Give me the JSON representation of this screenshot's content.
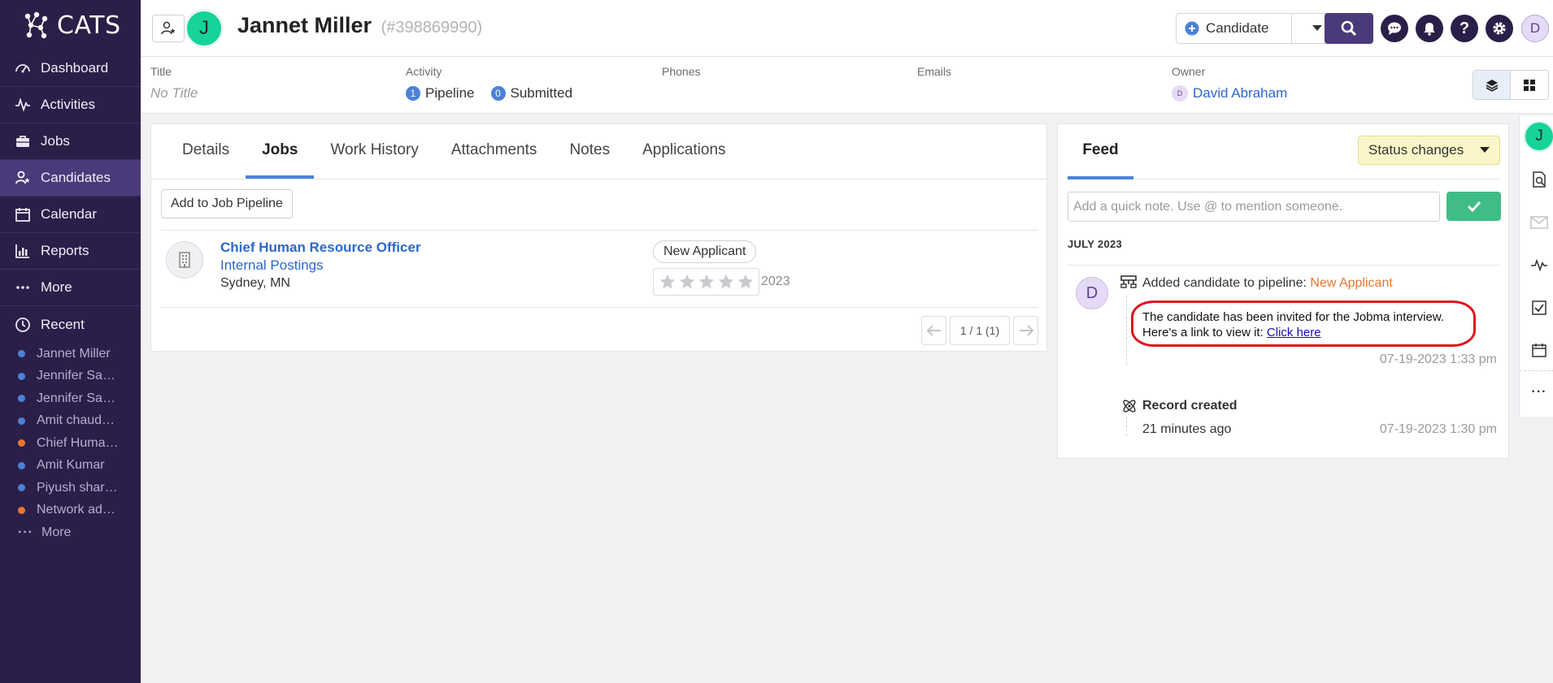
{
  "app": {
    "logo_text": "CATS"
  },
  "sidebar": {
    "items": [
      {
        "label": "Dashboard",
        "icon": "dashboard-icon"
      },
      {
        "label": "Activities",
        "icon": "activity-icon"
      },
      {
        "label": "Jobs",
        "icon": "briefcase-icon"
      },
      {
        "label": "Candidates",
        "icon": "candidate-icon"
      },
      {
        "label": "Calendar",
        "icon": "calendar-icon"
      },
      {
        "label": "Reports",
        "icon": "reports-icon"
      },
      {
        "label": "More",
        "icon": "more-icon"
      }
    ],
    "recent_label": "Recent",
    "recent": [
      {
        "label": "Jannet Miller",
        "color": "#4b82d8"
      },
      {
        "label": "Jennifer Sa…",
        "color": "#4b82d8"
      },
      {
        "label": "Jennifer Sa…",
        "color": "#4b82d8"
      },
      {
        "label": "Amit chaud…",
        "color": "#4b82d8"
      },
      {
        "label": "Chief Huma…",
        "color": "#e8772e"
      },
      {
        "label": "Amit Kumar",
        "color": "#4b82d8"
      },
      {
        "label": "Piyush shar…",
        "color": "#4b82d8"
      },
      {
        "label": "Network ad…",
        "color": "#e8772e"
      }
    ],
    "recent_more": "More"
  },
  "header": {
    "avatar_letter": "J",
    "name": "Jannet Miller",
    "record_id": "(#398869990)",
    "quick_add_label": "Candidate",
    "user_initial": "D"
  },
  "info": {
    "title_label": "Title",
    "title_value": "No Title",
    "activity_label": "Activity",
    "pipeline_count": "1",
    "pipeline_label": "Pipeline",
    "submitted_count": "0",
    "submitted_label": "Submitted",
    "phones_label": "Phones",
    "emails_label": "Emails",
    "owner_label": "Owner",
    "owner_initial": "D",
    "owner_name": "David Abraham"
  },
  "jobs_panel": {
    "tabs": [
      "Details",
      "Jobs",
      "Work History",
      "Attachments",
      "Notes",
      "Applications"
    ],
    "add_button": "Add to Job Pipeline",
    "job": {
      "title": "Chief Human Resource Officer",
      "company": "Internal Postings",
      "location": "Sydney, MN",
      "status": "New Applicant",
      "rating": 0,
      "date_suffix": "2023"
    },
    "pager": "1 / 1 (1)"
  },
  "feed": {
    "tab": "Feed",
    "filter": "Status changes",
    "note_placeholder": "Add a quick note. Use @ to mention someone.",
    "month": "JULY 2023",
    "avatar_letter": "D",
    "event1_prefix": "Added candidate to pipeline:",
    "event1_status": "New Applicant",
    "event1_message_1": "The candidate has been invited for the Jobma interview.",
    "event1_message_2": "Here's a link to view it:",
    "event1_link": "Click here",
    "event1_date": "07-19-2023 1:33 pm",
    "event2_title": "Record created",
    "event2_relative": "21 minutes ago",
    "event2_date": "07-19-2023 1:30 pm"
  },
  "rail": {
    "avatar_letter": "J"
  }
}
